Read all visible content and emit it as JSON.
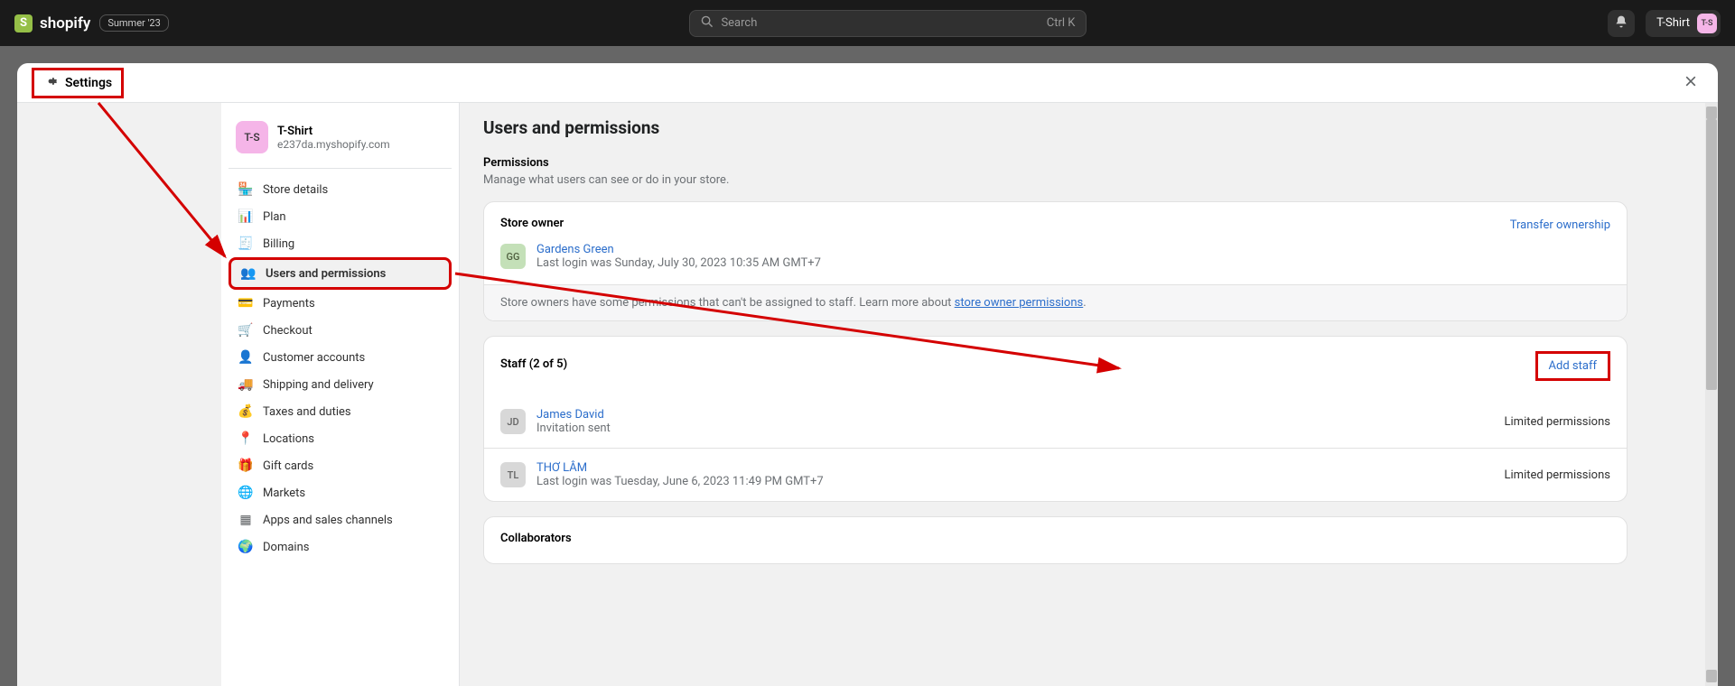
{
  "topbar": {
    "brand": "shopify",
    "badge": "Summer '23",
    "search_placeholder": "Search",
    "search_shortcut": "Ctrl K",
    "store_name": "T-Shirt",
    "store_initials": "T-S"
  },
  "modal": {
    "title": "Settings"
  },
  "store": {
    "name": "T-Shirt",
    "initials": "T-S",
    "domain": "e237da.myshopify.com"
  },
  "nav": {
    "items": [
      {
        "label": "Store details",
        "icon": "🏪"
      },
      {
        "label": "Plan",
        "icon": "📊"
      },
      {
        "label": "Billing",
        "icon": "🧾"
      },
      {
        "label": "Users and permissions",
        "icon": "👥"
      },
      {
        "label": "Payments",
        "icon": "💳"
      },
      {
        "label": "Checkout",
        "icon": "🛒"
      },
      {
        "label": "Customer accounts",
        "icon": "👤"
      },
      {
        "label": "Shipping and delivery",
        "icon": "🚚"
      },
      {
        "label": "Taxes and duties",
        "icon": "💰"
      },
      {
        "label": "Locations",
        "icon": "📍"
      },
      {
        "label": "Gift cards",
        "icon": "🎁"
      },
      {
        "label": "Markets",
        "icon": "🌐"
      },
      {
        "label": "Apps and sales channels",
        "icon": "▦"
      },
      {
        "label": "Domains",
        "icon": "🌍"
      }
    ]
  },
  "main": {
    "title": "Users and permissions",
    "permissions_heading": "Permissions",
    "permissions_sub": "Manage what users can see or do in your store.",
    "store_owner_label": "Store owner",
    "transfer_label": "Transfer ownership",
    "owner": {
      "name": "Gardens Green",
      "initials": "GG",
      "avatar_bg": "#c4e0b8",
      "sub": "Last login was Sunday, July 30, 2023 10:35 AM GMT+7"
    },
    "owner_footer_pre": "Store owners have some permissions that can't be assigned to staff. Learn more about ",
    "owner_footer_link": "store owner permissions",
    "owner_footer_post": ".",
    "staff_label": "Staff (2 of 5)",
    "add_staff": "Add staff",
    "staff": [
      {
        "name": "James David",
        "initials": "JD",
        "avatar_bg": "#d8d8d8",
        "sub": "Invitation sent",
        "perm": "Limited permissions"
      },
      {
        "name": "THƠ LÂM",
        "initials": "TL",
        "avatar_bg": "#d8d8d8",
        "sub": "Last login was Tuesday, June 6, 2023 11:49 PM GMT+7",
        "perm": "Limited permissions"
      }
    ],
    "collaborators_heading": "Collaborators"
  }
}
